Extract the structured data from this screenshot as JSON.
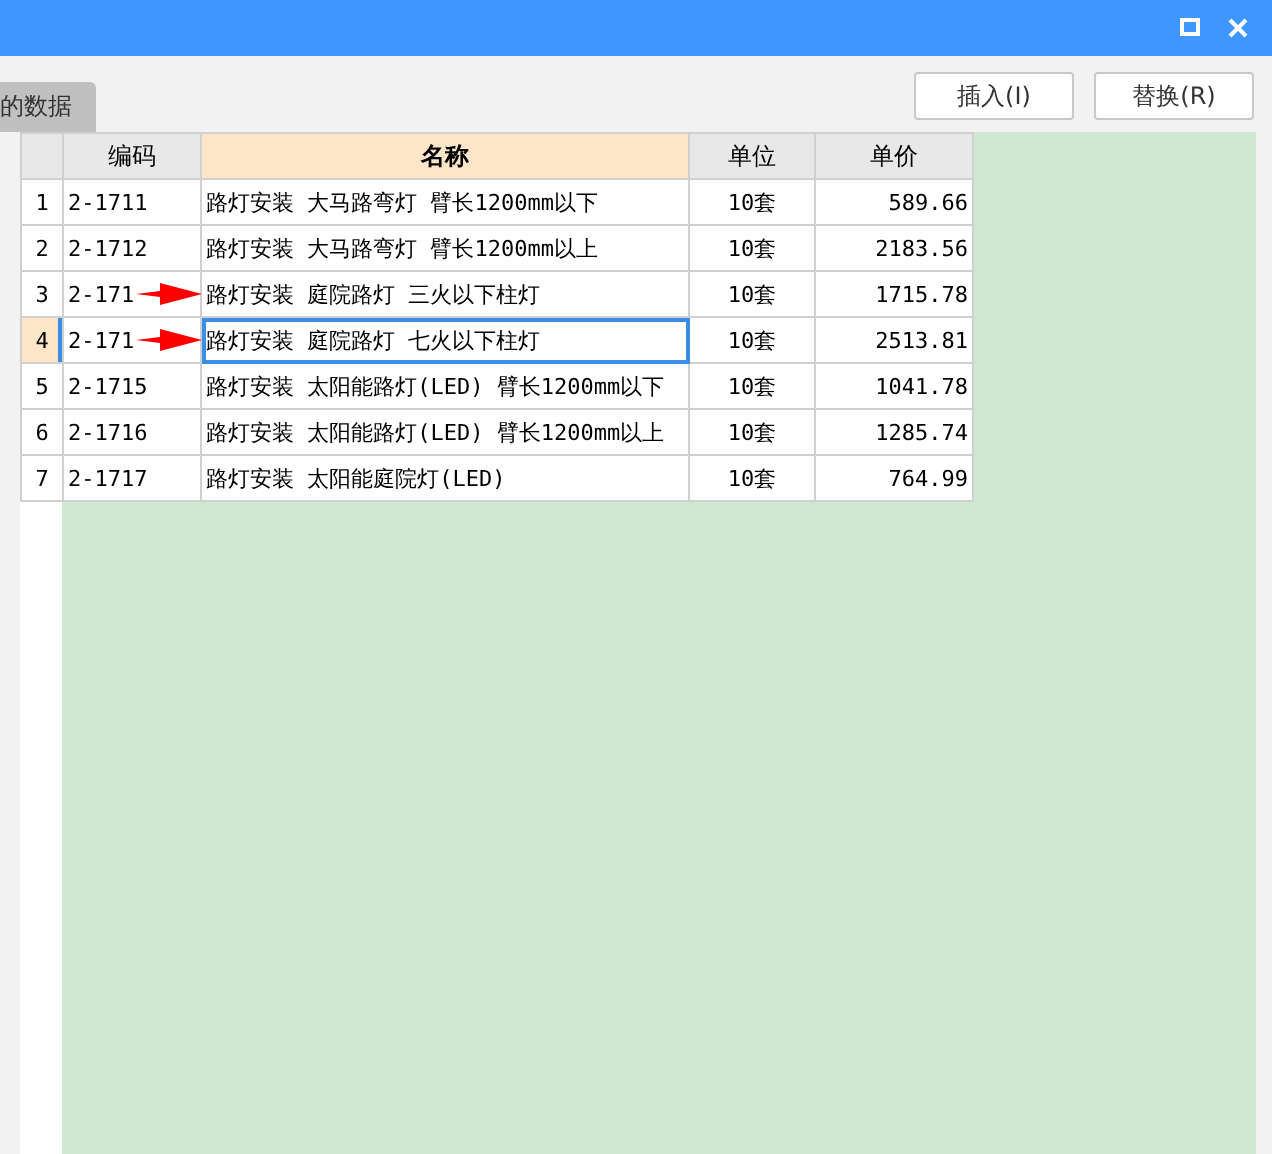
{
  "tabs": [
    {
      "label": "的数据",
      "selected": true
    }
  ],
  "buttons": [
    "插入(I)",
    "替换(R)"
  ],
  "table": {
    "columns": [
      {
        "label": "编码",
        "highlighted": false
      },
      {
        "label": "名称",
        "highlighted": true
      },
      {
        "label": "单位",
        "highlighted": false
      },
      {
        "label": "单价",
        "highlighted": false
      }
    ],
    "rows": [
      {
        "number": "1",
        "cells": [
          "2-1711",
          "路灯安装 大马路弯灯 臂长1200mm以下",
          "10套",
          "589.66"
        ],
        "selected": false,
        "arrow": false
      },
      {
        "number": "2",
        "cells": [
          "2-1712",
          "路灯安装 大马路弯灯 臂长1200mm以上",
          "10套",
          "2183.56"
        ],
        "selected": false,
        "arrow": false
      },
      {
        "number": "3",
        "cells": [
          "2-171",
          "路灯安装 庭院路灯 三火以下柱灯",
          "10套",
          "1715.78"
        ],
        "selected": false,
        "arrow": true
      },
      {
        "number": "4",
        "cells": [
          "2-171",
          "路灯安装 庭院路灯 七火以下柱灯",
          "10套",
          "2513.81"
        ],
        "selected": true,
        "arrow": true
      },
      {
        "number": "5",
        "cells": [
          "2-1715",
          "路灯安装 太阳能路灯(LED) 臂长1200mm以下",
          "10套",
          "1041.78"
        ],
        "selected": false,
        "arrow": false
      },
      {
        "number": "6",
        "cells": [
          "2-1716",
          "路灯安装 太阳能路灯(LED) 臂长1200mm以上",
          "10套",
          "1285.74"
        ],
        "selected": false,
        "arrow": false
      },
      {
        "number": "7",
        "cells": [
          "2-1717",
          "路灯安装 太阳能庭院灯(LED)",
          "10套",
          "764.99"
        ],
        "selected": false,
        "arrow": false
      }
    ]
  }
}
